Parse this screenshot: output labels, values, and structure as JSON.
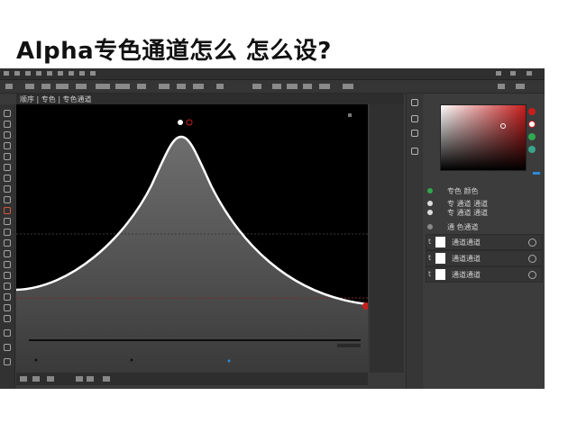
{
  "headline": "Alpha专色通道怎么 怎么设?",
  "document_tab": "顺序 | 专色 | 专色通道",
  "colors": {
    "accent_red": "#c81e1e",
    "accent_blue": "#2a8ad8",
    "accent_green": "#2fa84f",
    "curve": "#ffffff"
  },
  "layers_panel": {
    "rows": [
      {
        "label": "专色 颜色",
        "icon": "eye-icon"
      },
      {
        "label": "专 通道 通道",
        "icon": "eye-icon"
      },
      {
        "label": "专 通道 通道",
        "icon": "eye-icon"
      },
      {
        "label": "通 色通道",
        "icon": "eye-icon"
      }
    ]
  },
  "channels_panel": {
    "rows": [
      {
        "index": "t",
        "label": "通道通道"
      },
      {
        "index": "t",
        "label": "通道通道"
      },
      {
        "index": "t",
        "label": "通道通道"
      }
    ]
  }
}
